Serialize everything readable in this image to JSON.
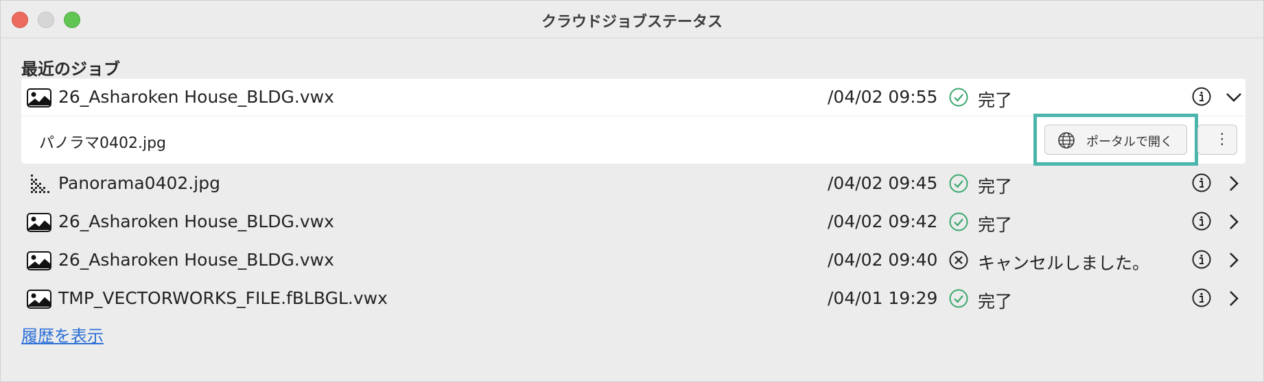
{
  "window": {
    "title": "クラウドジョブステータス"
  },
  "section": {
    "title": "最近のジョブ"
  },
  "jobs": [
    {
      "name": "26_Asharoken House_BLDG.vwx",
      "date": "/04/02 09:55",
      "status": "完了",
      "status_icon": "check-circle-icon",
      "file_icon": "image-file-icon",
      "expanded": true
    },
    {
      "name": "Panorama0402.jpg",
      "date": "/04/02 09:45",
      "status": "完了",
      "status_icon": "check-circle-icon",
      "file_icon": "raster-image-icon",
      "expanded": false
    },
    {
      "name": "26_Asharoken House_BLDG.vwx",
      "date": "/04/02 09:42",
      "status": "完了",
      "status_icon": "check-circle-icon",
      "file_icon": "image-file-icon",
      "expanded": false
    },
    {
      "name": "26_Asharoken House_BLDG.vwx",
      "date": "/04/02 09:40",
      "status": "キャンセルしました。",
      "status_icon": "cancel-circle-icon",
      "file_icon": "image-file-icon",
      "expanded": false
    },
    {
      "name": "TMP_VECTORWORKS_FILE.fBLBGL.vwx",
      "date": "/04/01 19:29",
      "status": "完了",
      "status_icon": "check-circle-icon",
      "file_icon": "image-file-icon",
      "expanded": false
    }
  ],
  "expanded_detail": {
    "output_file": "パノラマ0402.jpg",
    "open_portal_label": "ポータルで開く",
    "more_label": "⋮"
  },
  "footer": {
    "history_link": "履歴を表示"
  },
  "colors": {
    "success": "#3aa76d",
    "highlight": "#4bb5ac",
    "link": "#2b6fd6"
  }
}
